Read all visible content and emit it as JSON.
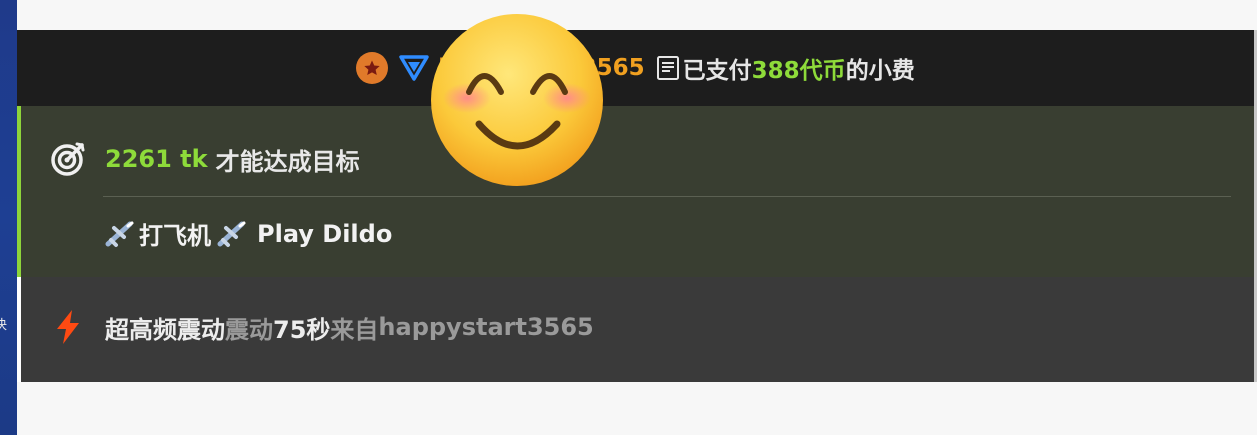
{
  "desktop": {
    "edge_char": "决"
  },
  "tip": {
    "username": "happystart3565",
    "action": "已支付",
    "amount": "388代币",
    "suffix": "的小费"
  },
  "goal": {
    "tokens": "2261 tk",
    "text": "才能达成目标",
    "reward_cn": "打飞机",
    "reward_en": "Play Dildo"
  },
  "vibe": {
    "level": "超高频震动",
    "word": "震动",
    "duration": "75秒",
    "from": "来自",
    "username": "happystart3565"
  },
  "colors": {
    "accent_green": "#8edb3a",
    "username_orange": "#f0a020",
    "bolt_red": "#ff4a12",
    "triangle_blue": "#2f8cff"
  },
  "icons": [
    "star-badge-icon",
    "triangle-icon",
    "document-icon",
    "target-icon",
    "airplane-icon",
    "lightning-icon",
    "smiling-face-emoji"
  ]
}
